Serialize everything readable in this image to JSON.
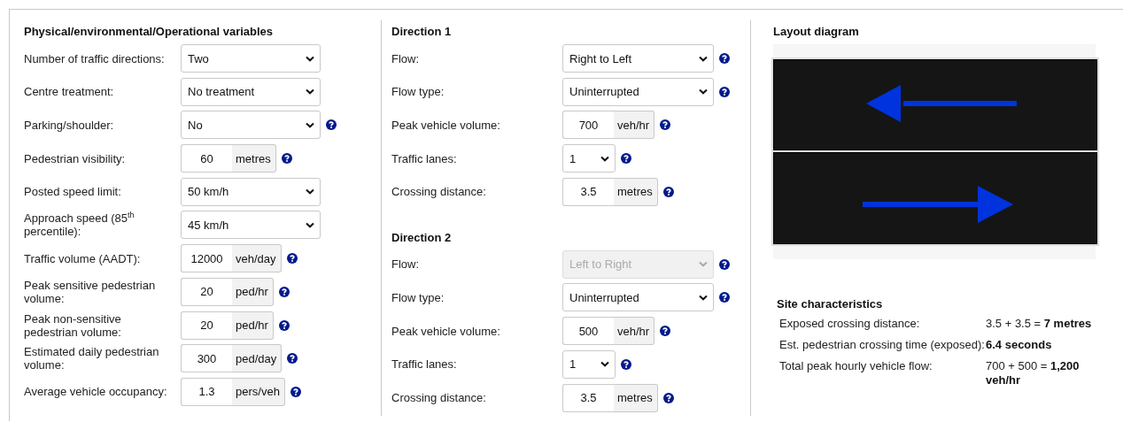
{
  "variables": {
    "title": "Physical/environmental/Operational variables",
    "fields": [
      {
        "label": "Number of traffic directions:",
        "kind": "select",
        "value": "Two",
        "disabled": false,
        "help": false
      },
      {
        "label": "Centre treatment:",
        "kind": "select",
        "value": "No treatment",
        "disabled": false,
        "help": false
      },
      {
        "label": "Parking/shoulder:",
        "kind": "select",
        "value": "No",
        "disabled": false,
        "help": true
      },
      {
        "label": "Pedestrian visibility:",
        "kind": "number",
        "value": "60",
        "unit": "metres",
        "help": true
      },
      {
        "label": "Posted speed limit:",
        "kind": "select",
        "value": "50 km/h",
        "disabled": false,
        "help": false
      },
      {
        "label": "Approach speed (85$^{th}$ percentile):",
        "kind": "select",
        "value": "45 km/h",
        "disabled": false,
        "help": false
      },
      {
        "label": "Traffic volume (AADT):",
        "kind": "number",
        "value": "12000",
        "unit": "veh/day",
        "help": true
      },
      {
        "label": "Peak sensitive pedestrian volume:",
        "kind": "number",
        "value": "20",
        "unit": "ped/hr",
        "help": true
      },
      {
        "label": "Peak non-sensitive pedestrian volume:",
        "kind": "number",
        "value": "20",
        "unit": "ped/hr",
        "help": true
      },
      {
        "label": "Estimated daily pedestrian volume:",
        "kind": "number",
        "value": "300",
        "unit": "ped/day",
        "help": true
      },
      {
        "label": "Average vehicle occupancy:",
        "kind": "number",
        "value": "1.3",
        "unit": "pers/veh",
        "help": true
      }
    ]
  },
  "directions": [
    {
      "title": "Direction 1",
      "fields": [
        {
          "label": "Flow:",
          "kind": "select",
          "value": "Right to Left",
          "disabled": false,
          "help": true
        },
        {
          "label": "Flow type:",
          "kind": "select",
          "value": "Uninterrupted",
          "disabled": false,
          "help": true
        },
        {
          "label": "Peak vehicle volume:",
          "kind": "number",
          "value": "700",
          "unit": "veh/hr",
          "help": true
        },
        {
          "label": "Traffic lanes:",
          "kind": "short-select",
          "value": "1",
          "disabled": false,
          "help": true
        },
        {
          "label": "Crossing distance:",
          "kind": "number",
          "value": "3.5",
          "unit": "metres",
          "help": true
        }
      ]
    },
    {
      "title": "Direction 2",
      "fields": [
        {
          "label": "Flow:",
          "kind": "select",
          "value": "Left to Right",
          "disabled": true,
          "help": true
        },
        {
          "label": "Flow type:",
          "kind": "select",
          "value": "Uninterrupted",
          "disabled": false,
          "help": true
        },
        {
          "label": "Peak vehicle volume:",
          "kind": "number",
          "value": "500",
          "unit": "veh/hr",
          "help": true
        },
        {
          "label": "Traffic lanes:",
          "kind": "short-select",
          "value": "1",
          "disabled": false,
          "help": true
        },
        {
          "label": "Crossing distance:",
          "kind": "number",
          "value": "3.5",
          "unit": "metres",
          "help": true
        }
      ]
    }
  ],
  "layout": {
    "title": "Layout diagram",
    "lanes": [
      {
        "kind": "leftward"
      },
      {
        "kind": "rightward"
      }
    ]
  },
  "site": {
    "title": "Site characteristics",
    "rows": [
      {
        "label": "Exposed crossing distance:",
        "value": "3.5 + 3.5 = **7 metres**"
      },
      {
        "label": "Est. pedestrian crossing time (exposed):",
        "value": "**6.4 seconds**"
      },
      {
        "label": "Total peak hourly vehicle flow:",
        "value": "700 + 500 = **1,200 veh/hr**"
      }
    ]
  }
}
